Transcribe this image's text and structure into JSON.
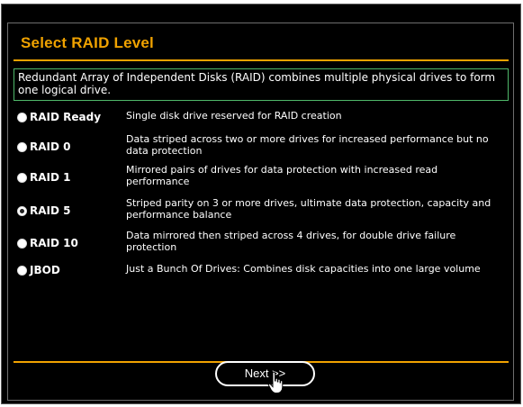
{
  "dialog": {
    "title": "Select RAID Level",
    "description": "Redundant Array of Independent Disks (RAID) combines multiple physical drives to form one logical drive."
  },
  "options": [
    {
      "label": "RAID Ready",
      "description": "Single disk drive reserved for RAID creation",
      "selected": false
    },
    {
      "label": "RAID 0",
      "description": "Data striped across two or more drives for increased performance but no data protection",
      "selected": false
    },
    {
      "label": "RAID 1",
      "description": "Mirrored pairs of drives for data protection with increased read performance",
      "selected": false
    },
    {
      "label": "RAID 5",
      "description": "Striped parity on 3 or more drives, ultimate data protection, capacity and performance balance",
      "selected": true
    },
    {
      "label": "RAID 10",
      "description": "Data mirrored then striped across 4 drives, for double drive failure protection",
      "selected": false
    },
    {
      "label": "JBOD",
      "description": "Just a Bunch Of Drives: Combines disk capacities into one large volume",
      "selected": false
    }
  ],
  "buttons": {
    "next_label": "Next >>"
  },
  "icons": {
    "cursor": "hand-pointer-icon"
  },
  "colors": {
    "accent": "#f0a200",
    "description_border": "#4fb86a",
    "background": "#000000",
    "text": "#ffffff"
  }
}
